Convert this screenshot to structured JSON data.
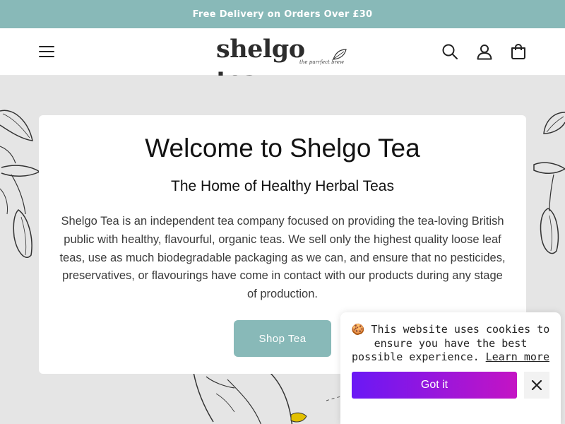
{
  "announcement": {
    "text": "Free Delivery on Orders Over £30"
  },
  "header": {
    "logo_text": "shelgo tea",
    "logo_tagline": "the purrfect brew",
    "icons": [
      "menu-icon",
      "search-icon",
      "account-icon",
      "cart-icon"
    ]
  },
  "hero": {
    "title": "Welcome to Shelgo Tea",
    "subtitle": "The Home of Healthy Herbal Teas",
    "body": "Shelgo Tea is an independent tea company focused on providing the tea-loving British public with healthy, flavourful, organic teas. We sell only the highest quality loose leaf teas, use as much biodegradable packaging as we can, and ensure that no pesticides, preservatives, or flavourings have come in contact with our products during any stage of production.",
    "cta_label": "Shop Tea"
  },
  "cookie_banner": {
    "emoji": "🍪",
    "message": "This website uses cookies to ensure you have the best possible experience.",
    "link_label": "Learn more",
    "accept_label": "Got it",
    "close_icon": "close-icon"
  },
  "colors": {
    "accent": "#88b9b8",
    "hero_background": "#e5e5e5",
    "cookie_gradient_start": "#6a18f5",
    "cookie_gradient_end": "#c414c4"
  }
}
